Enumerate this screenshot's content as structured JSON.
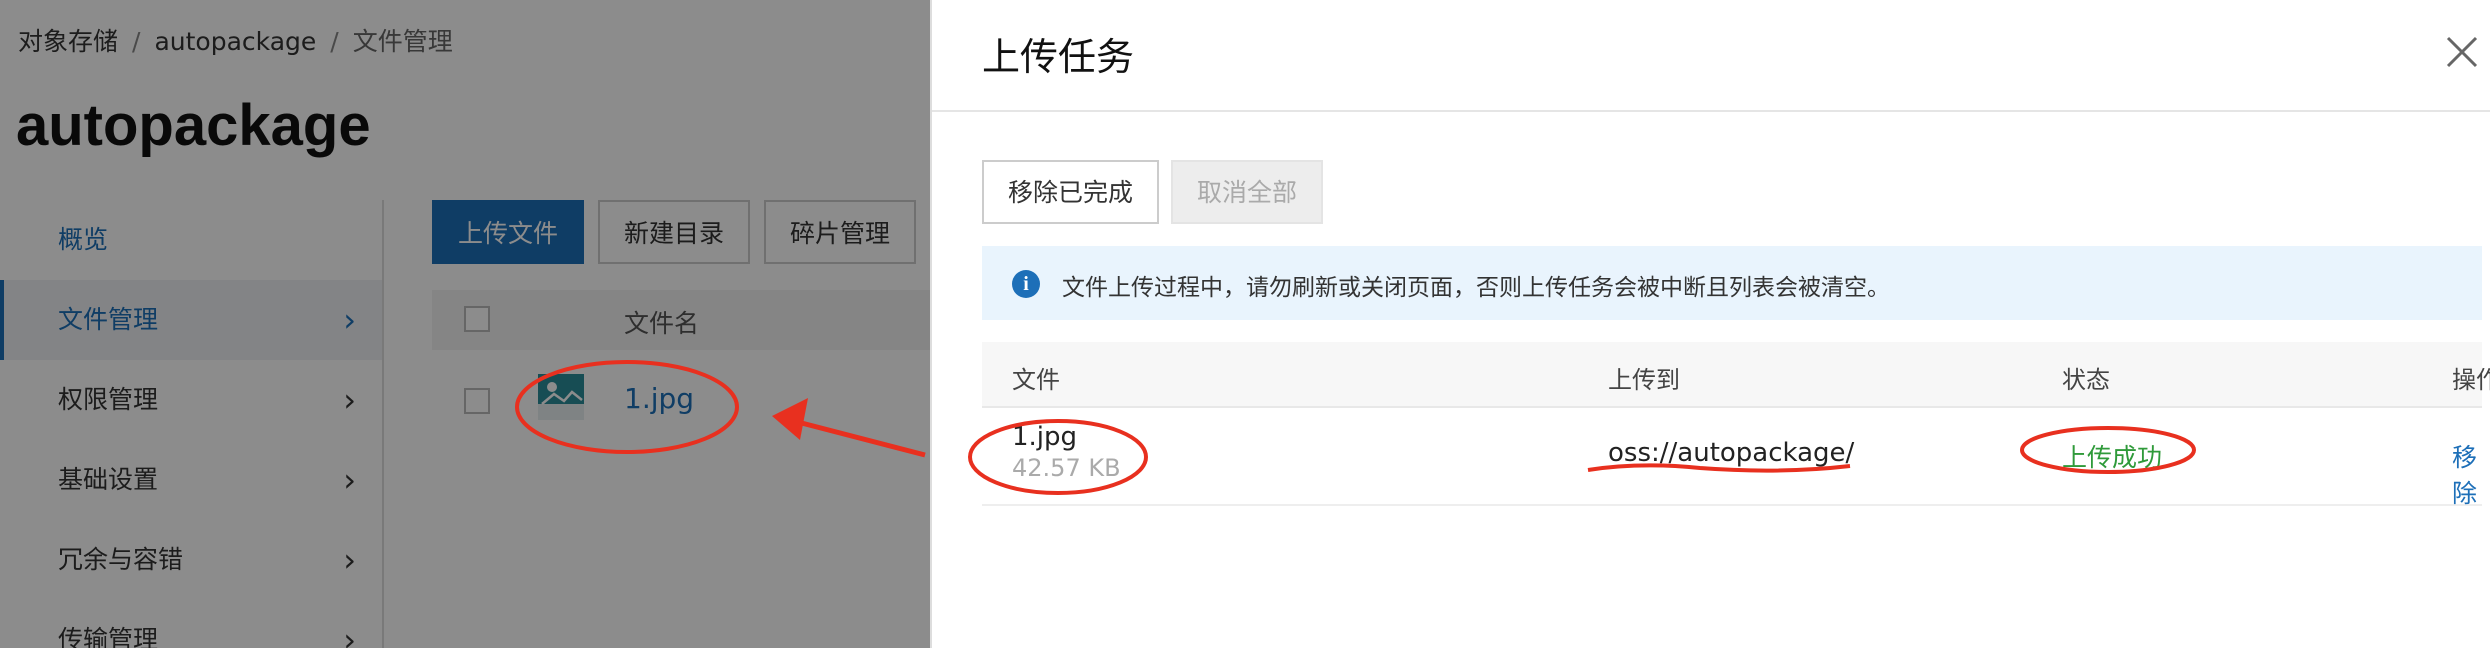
{
  "background": {
    "breadcrumb": {
      "root": "对象存储",
      "bucket": "autopackage",
      "current": "文件管理",
      "sep": "/"
    },
    "title": "autopackage",
    "sidebar": [
      {
        "label": "概览"
      },
      {
        "label": "文件管理"
      },
      {
        "label": "权限管理"
      },
      {
        "label": "基础设置"
      },
      {
        "label": "冗余与容错"
      },
      {
        "label": "传输管理"
      }
    ],
    "toolbar": {
      "upload": "上传文件",
      "new_dir": "新建目录",
      "fragments": "碎片管理"
    },
    "list": {
      "column_name": "文件名",
      "file": "1.jpg"
    }
  },
  "drawer": {
    "title": "上传任务",
    "remove_done": "移除已完成",
    "cancel_all": "取消全部",
    "notice": "文件上传过程中，请勿刷新或关闭页面，否则上传任务会被中断且列表会被清空。",
    "columns": {
      "file": "文件",
      "dest": "上传到",
      "status": "状态",
      "action": "操作"
    },
    "row": {
      "file": "1.jpg",
      "size": "42.57 KB",
      "dest": "oss://autopackage/",
      "status": "上传成功",
      "action": "移除"
    }
  },
  "colors": {
    "primary": "#1d6fb8",
    "success": "#2f9a3a",
    "annotation": "#e8301f"
  }
}
